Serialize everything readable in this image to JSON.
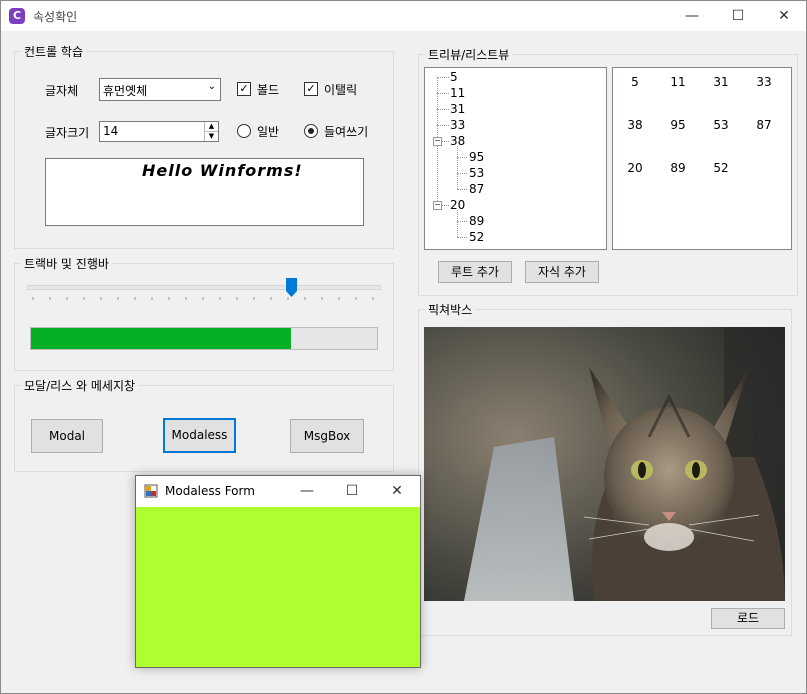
{
  "window": {
    "title": "속성확인",
    "icon": "C"
  },
  "controls_group": {
    "title": "컨트롤 학습",
    "font_label": "글자체",
    "font_value": "휴먼옛체",
    "bold_label": "볼드",
    "bold_checked": true,
    "italic_label": "이탤릭",
    "italic_checked": true,
    "size_label": "글자크기",
    "size_value": "14",
    "normal_label": "일반",
    "indent_label": "들여쓰기",
    "preview_text": "Hello Winforms!"
  },
  "trackbar_group": {
    "title": "트랙바 및 진행바",
    "slider_value": 0.75,
    "progress_value": 0.75,
    "progress_color": "#06b025"
  },
  "modal_group": {
    "title": "모달/리스 와 메세지창",
    "modal_label": "Modal",
    "modaless_label": "Modaless",
    "msgbox_label": "MsgBox"
  },
  "tree_group": {
    "title": "트리뷰/리스트뷰",
    "tree": [
      "5",
      "11",
      "31",
      "33",
      "38",
      "95",
      "53",
      "87",
      "20",
      "89",
      "52"
    ],
    "list": [
      "5",
      "11",
      "31",
      "33",
      "38",
      "95",
      "53",
      "87",
      "20",
      "89",
      "52"
    ],
    "root_button": "루트 추가",
    "child_button": "자식 추가"
  },
  "picture_group": {
    "title": "픽쳐박스",
    "load_button": "로드"
  },
  "modaless_form": {
    "title": "Modaless Form",
    "background": "#adff2f"
  }
}
